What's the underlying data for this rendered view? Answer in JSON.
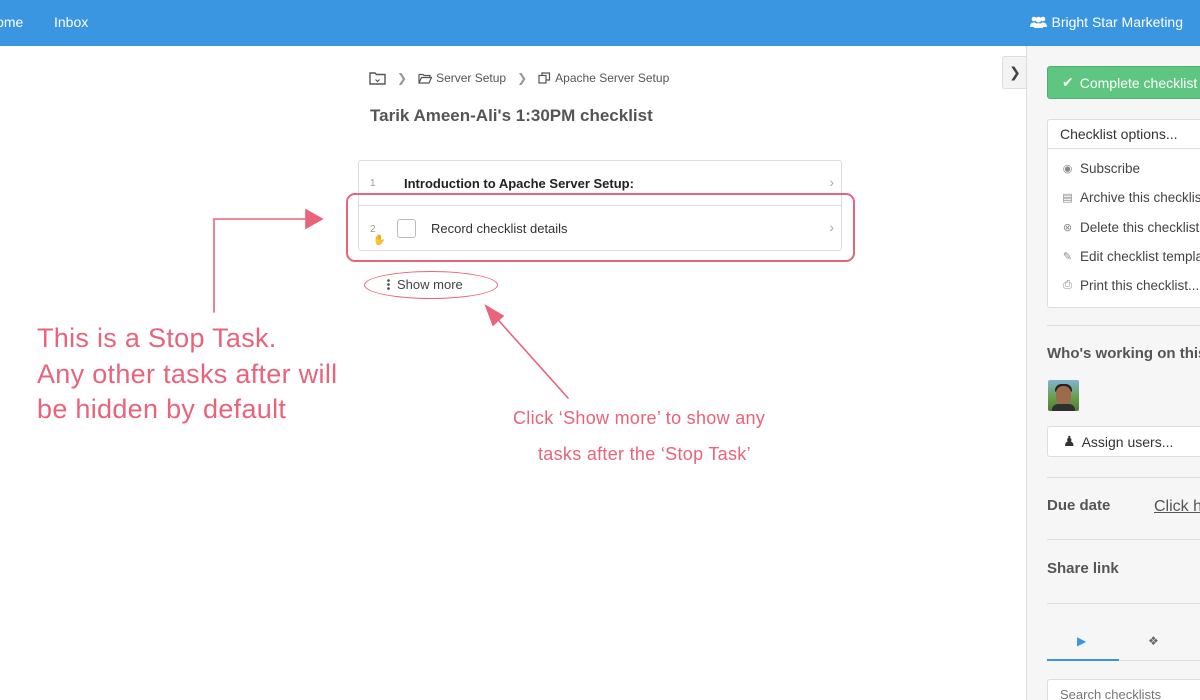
{
  "topnav": {
    "links": [
      {
        "label": "Home"
      },
      {
        "label": "Inbox"
      }
    ],
    "organization": "Bright Star Marketing"
  },
  "breadcrumb": {
    "items": [
      {
        "label": "Server Setup",
        "icon": "folder-open-icon"
      },
      {
        "label": "Apache Server Setup",
        "icon": "template-copy-icon"
      }
    ],
    "root_icon": "folder-icon"
  },
  "page_title": "Tarik Ameen-Ali's 1:30PM checklist",
  "tasks": [
    {
      "number": "1",
      "label": "Introduction to Apache Server Setup:",
      "type": "heading"
    },
    {
      "number": "2",
      "label": "Record checklist details",
      "type": "stop-task",
      "checked": false
    }
  ],
  "show_more": "Show more",
  "annotations": {
    "stop_task": [
      "This is a Stop Task.",
      "Any other tasks after will",
      "be hidden by default"
    ],
    "show_more_hint": [
      "Click ‘Show more’ to show any",
      "tasks after the ‘Stop Task’"
    ],
    "color": "#e9637b"
  },
  "sidebar": {
    "complete_button": "Complete checklist",
    "options_label": "Checklist options...",
    "options": [
      {
        "label": "Subscribe",
        "icon": "eye-icon"
      },
      {
        "label": "Archive this checklist",
        "icon": "briefcase-icon"
      },
      {
        "label": "Delete this checklist",
        "icon": "times-circle-icon"
      },
      {
        "label": "Edit checklist template",
        "icon": "pencil-icon"
      },
      {
        "label": "Print this checklist...",
        "icon": "print-icon"
      }
    ],
    "working_heading": "Who's working on this?",
    "assign_button": "Assign users...",
    "due_date_label": "Due date",
    "due_date_link": "Click here",
    "share_link_label": "Share link",
    "search_placeholder": "Search checklists"
  },
  "colors": {
    "topbar": "#3a96e0",
    "complete_green": "#5ec680",
    "annotation_pink": "#e9637b"
  }
}
